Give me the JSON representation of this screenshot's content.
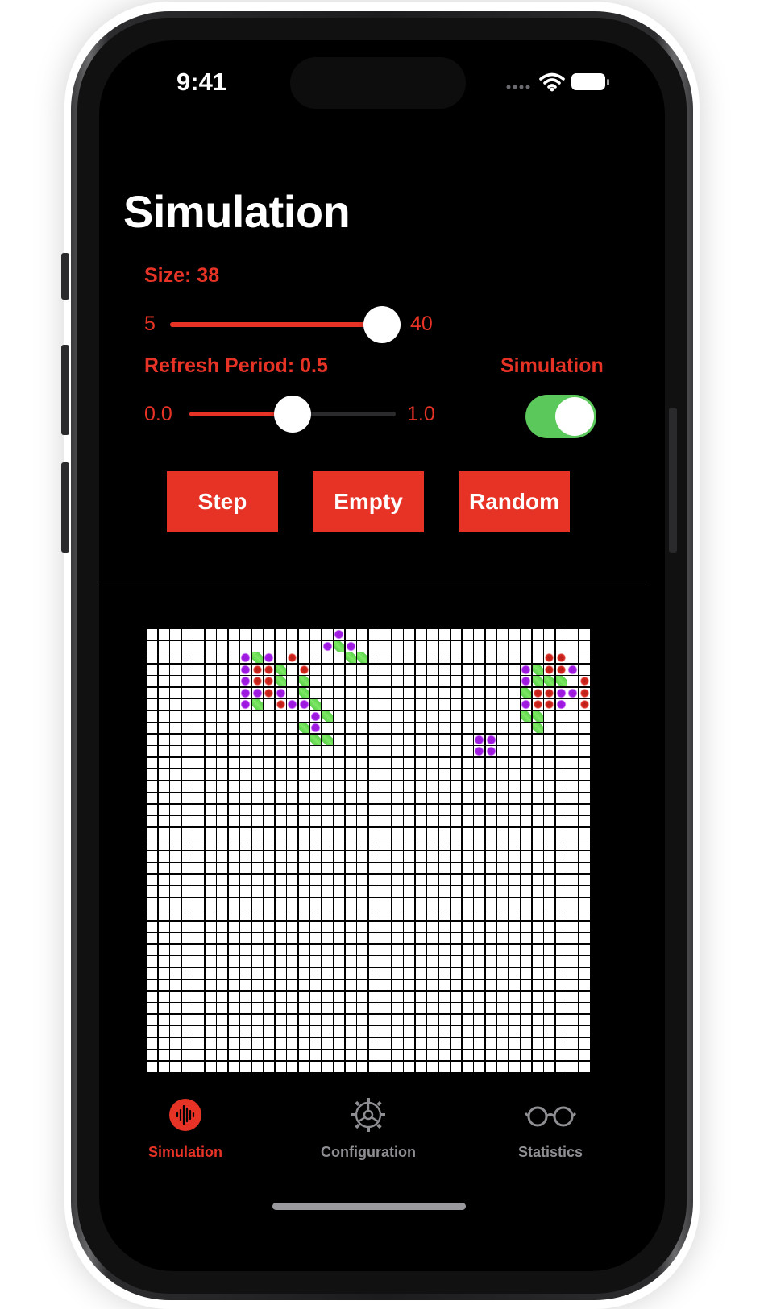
{
  "status_bar": {
    "time": "9:41"
  },
  "page_title": "Simulation",
  "size_control": {
    "label": "Size: 38",
    "min_label": "5",
    "max_label": "40",
    "value_fraction": 0.94
  },
  "refresh_control": {
    "label": "Refresh Period: 0.5",
    "min_label": "0.0",
    "max_label": "1.0",
    "value_fraction": 0.5
  },
  "simulation_toggle": {
    "label": "Simulation",
    "on": true
  },
  "buttons": {
    "step": "Step",
    "empty": "Empty",
    "random": "Random"
  },
  "grid": {
    "size": 38,
    "legend": {
      "0": "empty",
      "1": "red",
      "2": "purple",
      "3": "green"
    },
    "rows": [
      "00000000000000002000000000000000000000",
      "00000000000000023200000000000000000000",
      "00000000232010000330000000000000001100",
      "00000000211301000000000000000000231120",
      "00000000211303000000000000000000233301",
      "00000000221203000000000000000000311221",
      "00000000230122300000000000000000211201",
      "00000000000000230000000000000000330000",
      "00000000000003200000000000000000030000",
      "00000000000000330000000000002200000000",
      "00000000000000000000000000002200000000",
      "00000000000000000000000000000000000000",
      "00000000000000000000000000000000000000",
      "00000000000000000000000000000000000000",
      "00000000000000000000000000000000000000",
      "00000000000000000000000000000000000000",
      "00000000000000000000000000000000000000",
      "00000000000000000000000000000000000000",
      "00000000000000000000000000000000000000",
      "00000000000000000000000000000000000000",
      "00000000000000000000000000000000000000",
      "00000000000000000000000000000000000000",
      "00000000000000000000000000000000000000",
      "00000000000000000000000000000000000000",
      "00000000000000000000000000000000000000",
      "00000000000000000000000000000000000000",
      "00000000000000000000000000000000000000",
      "00000000000000000000000000000000000000",
      "00000000000000000000000000000000000000",
      "00000000000000000000000000000000000000",
      "00000000000000000000000000000000000000",
      "00000000000000000000000000000000000000",
      "00000000000000000000000000000000000000",
      "00000000000000000000000000000000000000",
      "00000000000000000000000000000000000000",
      "00000000000000000000000000000000000000",
      "00000000000000000000000000000000000000",
      "00000000000000000000000000000000000000"
    ]
  },
  "tabs": [
    {
      "label": "Simulation",
      "icon": "waveform-icon",
      "active": true
    },
    {
      "label": "Configuration",
      "icon": "gear-icon",
      "active": false
    },
    {
      "label": "Statistics",
      "icon": "eyeglasses-icon",
      "active": false
    }
  ],
  "colors": {
    "accent": "#e63326",
    "toggle_on": "#5ac85a",
    "inactive_tab": "#8e8e93"
  }
}
